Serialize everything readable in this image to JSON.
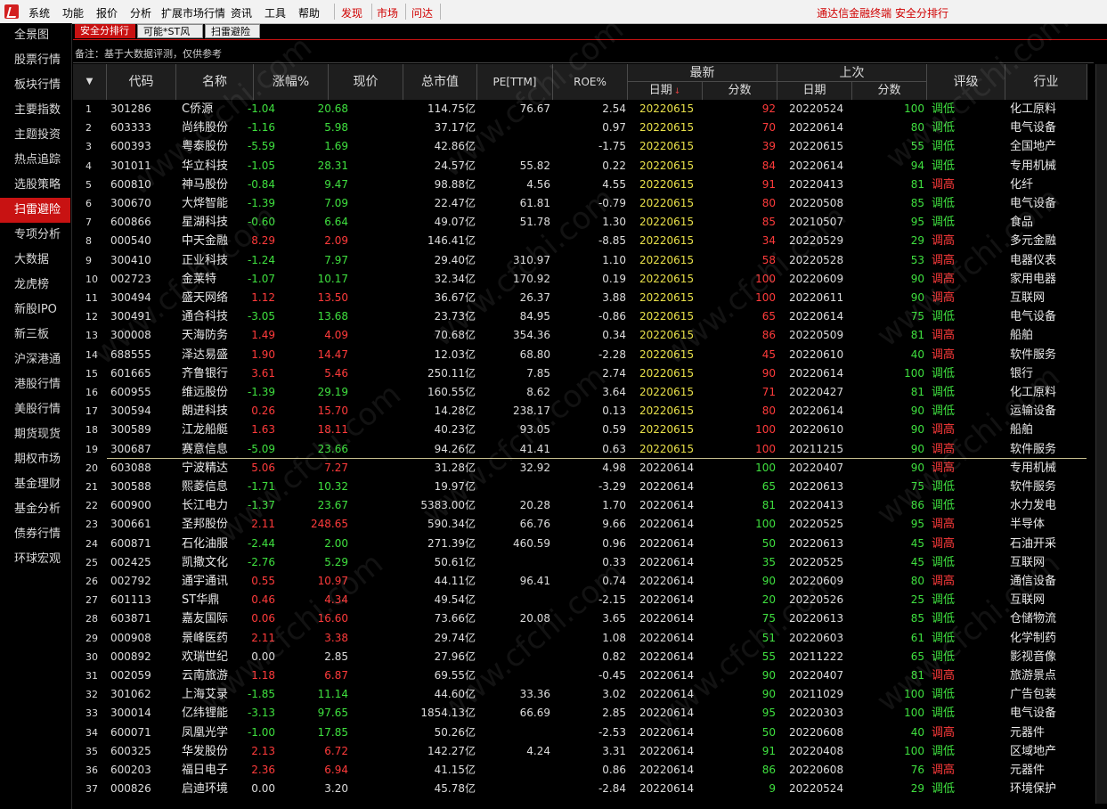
{
  "menu": {
    "items": [
      "系统",
      "功能",
      "报价",
      "分析",
      "扩展市场行情",
      "资讯",
      "工具",
      "帮助"
    ],
    "red_items": [
      "发现",
      "市场",
      "问达"
    ],
    "right_text": "通达信金融终端  安全分排行"
  },
  "sidebar": {
    "items": [
      "全景图",
      "股票行情",
      "板块行情",
      "主要指数",
      "主题投资",
      "热点追踪",
      "选股策略",
      "扫雷避险",
      "专项分析",
      "大数据",
      "龙虎榜",
      "新股IPO",
      "新三板",
      "沪深港通",
      "港股行情",
      "美股行情",
      "期货现货",
      "期权市场",
      "基金理财",
      "基金分析",
      "债券行情",
      "环球宏观"
    ],
    "active_index": 7
  },
  "tabs": [
    "安全分排行",
    "可能*ST风险",
    "扫雷避险"
  ],
  "note": "备注：基于大数据评测，仅供参考",
  "header": {
    "sort_icon": "sort-triangle-icon",
    "code": "代码",
    "name": "名称",
    "change": "涨幅%",
    "price": "现价",
    "market_cap": "总市值",
    "pe": "PE[TTM]",
    "roe": "ROE%",
    "latest": "最新",
    "previous": "上次",
    "date": "日期",
    "score": "分数",
    "rating": "评级",
    "industry": "行业"
  },
  "rows": [
    {
      "i": "1",
      "code": "301286",
      "name": "C侨源",
      "chg": "-1.04",
      "price": "20.68",
      "cap": "114.75亿",
      "pe": "76.67",
      "roe": "2.54",
      "d1": "20220615",
      "s1": "92",
      "d2": "20220524",
      "s2": "100",
      "rate": "调低",
      "ind": "化工原料"
    },
    {
      "i": "2",
      "code": "603333",
      "name": "尚纬股份",
      "chg": "-1.16",
      "price": "5.98",
      "cap": "37.17亿",
      "pe": "",
      "roe": "0.97",
      "d1": "20220615",
      "s1": "70",
      "d2": "20220614",
      "s2": "80",
      "rate": "调低",
      "ind": "电气设备"
    },
    {
      "i": "3",
      "code": "600393",
      "name": "粤泰股份",
      "chg": "-5.59",
      "price": "1.69",
      "cap": "42.86亿",
      "pe": "",
      "roe": "-1.75",
      "d1": "20220615",
      "s1": "39",
      "d2": "20220615",
      "s2": "55",
      "rate": "调低",
      "ind": "全国地产"
    },
    {
      "i": "4",
      "code": "301011",
      "name": "华立科技",
      "chg": "-1.05",
      "price": "28.31",
      "cap": "24.57亿",
      "pe": "55.82",
      "roe": "0.22",
      "d1": "20220615",
      "s1": "84",
      "d2": "20220614",
      "s2": "94",
      "rate": "调低",
      "ind": "专用机械"
    },
    {
      "i": "5",
      "code": "600810",
      "name": "神马股份",
      "chg": "-0.84",
      "price": "9.47",
      "cap": "98.88亿",
      "pe": "4.56",
      "roe": "4.55",
      "d1": "20220615",
      "s1": "91",
      "d2": "20220413",
      "s2": "81",
      "rate": "调高",
      "ind": "化纤"
    },
    {
      "i": "6",
      "code": "300670",
      "name": "大烨智能",
      "chg": "-1.39",
      "price": "7.09",
      "cap": "22.47亿",
      "pe": "61.81",
      "roe": "-0.79",
      "d1": "20220615",
      "s1": "80",
      "d2": "20220508",
      "s2": "85",
      "rate": "调低",
      "ind": "电气设备"
    },
    {
      "i": "7",
      "code": "600866",
      "name": "星湖科技",
      "chg": "-0.60",
      "price": "6.64",
      "cap": "49.07亿",
      "pe": "51.78",
      "roe": "1.30",
      "d1": "20220615",
      "s1": "85",
      "d2": "20210507",
      "s2": "95",
      "rate": "调低",
      "ind": "食品"
    },
    {
      "i": "8",
      "code": "000540",
      "name": "中天金融",
      "chg": "8.29",
      "price": "2.09",
      "cap": "146.41亿",
      "pe": "",
      "roe": "-8.85",
      "d1": "20220615",
      "s1": "34",
      "d2": "20220529",
      "s2": "29",
      "rate": "调高",
      "ind": "多元金融"
    },
    {
      "i": "9",
      "code": "300410",
      "name": "正业科技",
      "chg": "-1.24",
      "price": "7.97",
      "cap": "29.40亿",
      "pe": "310.97",
      "roe": "1.10",
      "d1": "20220615",
      "s1": "58",
      "d2": "20220528",
      "s2": "53",
      "rate": "调高",
      "ind": "电器仪表"
    },
    {
      "i": "10",
      "code": "002723",
      "name": "金莱特",
      "chg": "-1.07",
      "price": "10.17",
      "cap": "32.34亿",
      "pe": "170.92",
      "roe": "0.19",
      "d1": "20220615",
      "s1": "100",
      "d2": "20220609",
      "s2": "90",
      "rate": "调高",
      "ind": "家用电器"
    },
    {
      "i": "11",
      "code": "300494",
      "name": "盛天网络",
      "chg": "1.12",
      "price": "13.50",
      "cap": "36.67亿",
      "pe": "26.37",
      "roe": "3.88",
      "d1": "20220615",
      "s1": "100",
      "d2": "20220611",
      "s2": "90",
      "rate": "调高",
      "ind": "互联网"
    },
    {
      "i": "12",
      "code": "300491",
      "name": "通合科技",
      "chg": "-3.05",
      "price": "13.68",
      "cap": "23.73亿",
      "pe": "84.95",
      "roe": "-0.86",
      "d1": "20220615",
      "s1": "65",
      "d2": "20220614",
      "s2": "75",
      "rate": "调低",
      "ind": "电气设备"
    },
    {
      "i": "13",
      "code": "300008",
      "name": "天海防务",
      "chg": "1.49",
      "price": "4.09",
      "cap": "70.68亿",
      "pe": "354.36",
      "roe": "0.34",
      "d1": "20220615",
      "s1": "86",
      "d2": "20220509",
      "s2": "81",
      "rate": "调高",
      "ind": "船舶"
    },
    {
      "i": "14",
      "code": "688555",
      "name": "泽达易盛",
      "chg": "1.90",
      "price": "14.47",
      "cap": "12.03亿",
      "pe": "68.80",
      "roe": "-2.28",
      "d1": "20220615",
      "s1": "45",
      "d2": "20220610",
      "s2": "40",
      "rate": "调高",
      "ind": "软件服务"
    },
    {
      "i": "15",
      "code": "601665",
      "name": "齐鲁银行",
      "chg": "3.61",
      "price": "5.46",
      "cap": "250.11亿",
      "pe": "7.85",
      "roe": "2.74",
      "d1": "20220615",
      "s1": "90",
      "d2": "20220614",
      "s2": "100",
      "rate": "调低",
      "ind": "银行"
    },
    {
      "i": "16",
      "code": "600955",
      "name": "维远股份",
      "chg": "-1.39",
      "price": "29.19",
      "cap": "160.55亿",
      "pe": "8.62",
      "roe": "3.64",
      "d1": "20220615",
      "s1": "71",
      "d2": "20220427",
      "s2": "81",
      "rate": "调低",
      "ind": "化工原料"
    },
    {
      "i": "17",
      "code": "300594",
      "name": "朗进科技",
      "chg": "0.26",
      "price": "15.70",
      "cap": "14.28亿",
      "pe": "238.17",
      "roe": "0.13",
      "d1": "20220615",
      "s1": "80",
      "d2": "20220614",
      "s2": "90",
      "rate": "调低",
      "ind": "运输设备"
    },
    {
      "i": "18",
      "code": "300589",
      "name": "江龙船艇",
      "chg": "1.63",
      "price": "18.11",
      "cap": "40.23亿",
      "pe": "93.05",
      "roe": "0.59",
      "d1": "20220615",
      "s1": "100",
      "d2": "20220610",
      "s2": "90",
      "rate": "调高",
      "ind": "船舶"
    },
    {
      "i": "19",
      "code": "300687",
      "name": "赛意信息",
      "chg": "-5.09",
      "price": "23.66",
      "cap": "94.26亿",
      "pe": "41.41",
      "roe": "0.63",
      "d1": "20220615",
      "s1": "100",
      "d2": "20211215",
      "s2": "90",
      "rate": "调高",
      "ind": "软件服务"
    },
    {
      "i": "20",
      "code": "603088",
      "name": "宁波精达",
      "chg": "5.06",
      "price": "7.27",
      "cap": "31.28亿",
      "pe": "32.92",
      "roe": "4.98",
      "d1": "20220614",
      "s1": "100",
      "d2": "20220407",
      "s2": "90",
      "rate": "调高",
      "ind": "专用机械"
    },
    {
      "i": "21",
      "code": "300588",
      "name": "熙菱信息",
      "chg": "-1.71",
      "price": "10.32",
      "cap": "19.97亿",
      "pe": "",
      "roe": "-3.29",
      "d1": "20220614",
      "s1": "65",
      "d2": "20220613",
      "s2": "75",
      "rate": "调低",
      "ind": "软件服务"
    },
    {
      "i": "22",
      "code": "600900",
      "name": "长江电力",
      "chg": "-1.37",
      "price": "23.67",
      "cap": "5383.00亿",
      "pe": "20.28",
      "roe": "1.70",
      "d1": "20220614",
      "s1": "81",
      "d2": "20220413",
      "s2": "86",
      "rate": "调低",
      "ind": "水力发电"
    },
    {
      "i": "23",
      "code": "300661",
      "name": "圣邦股份",
      "chg": "2.11",
      "price": "248.65",
      "cap": "590.34亿",
      "pe": "66.76",
      "roe": "9.66",
      "d1": "20220614",
      "s1": "100",
      "d2": "20220525",
      "s2": "95",
      "rate": "调高",
      "ind": "半导体"
    },
    {
      "i": "24",
      "code": "600871",
      "name": "石化油服",
      "chg": "-2.44",
      "price": "2.00",
      "cap": "271.39亿",
      "pe": "460.59",
      "roe": "0.96",
      "d1": "20220614",
      "s1": "50",
      "d2": "20220613",
      "s2": "45",
      "rate": "调高",
      "ind": "石油开采"
    },
    {
      "i": "25",
      "code": "002425",
      "name": "凯撒文化",
      "chg": "-2.76",
      "price": "5.29",
      "cap": "50.61亿",
      "pe": "",
      "roe": "0.33",
      "d1": "20220614",
      "s1": "35",
      "d2": "20220525",
      "s2": "45",
      "rate": "调低",
      "ind": "互联网"
    },
    {
      "i": "26",
      "code": "002792",
      "name": "通宇通讯",
      "chg": "0.55",
      "price": "10.97",
      "cap": "44.11亿",
      "pe": "96.41",
      "roe": "0.74",
      "d1": "20220614",
      "s1": "90",
      "d2": "20220609",
      "s2": "80",
      "rate": "调高",
      "ind": "通信设备"
    },
    {
      "i": "27",
      "code": "601113",
      "name": "ST华鼎",
      "chg": "0.46",
      "price": "4.34",
      "cap": "49.54亿",
      "pe": "",
      "roe": "-2.15",
      "d1": "20220614",
      "s1": "20",
      "d2": "20220526",
      "s2": "25",
      "rate": "调低",
      "ind": "互联网"
    },
    {
      "i": "28",
      "code": "603871",
      "name": "嘉友国际",
      "chg": "0.06",
      "price": "16.60",
      "cap": "73.66亿",
      "pe": "20.08",
      "roe": "3.65",
      "d1": "20220614",
      "s1": "75",
      "d2": "20220613",
      "s2": "85",
      "rate": "调低",
      "ind": "仓储物流"
    },
    {
      "i": "29",
      "code": "000908",
      "name": "景峰医药",
      "chg": "2.11",
      "price": "3.38",
      "cap": "29.74亿",
      "pe": "",
      "roe": "1.08",
      "d1": "20220614",
      "s1": "51",
      "d2": "20220603",
      "s2": "61",
      "rate": "调低",
      "ind": "化学制药"
    },
    {
      "i": "30",
      "code": "000892",
      "name": "欢瑞世纪",
      "chg": "0.00",
      "price": "2.85",
      "cap": "27.96亿",
      "pe": "",
      "roe": "0.82",
      "d1": "20220614",
      "s1": "55",
      "d2": "20211222",
      "s2": "65",
      "rate": "调低",
      "ind": "影视音像"
    },
    {
      "i": "31",
      "code": "002059",
      "name": "云南旅游",
      "chg": "1.18",
      "price": "6.87",
      "cap": "69.55亿",
      "pe": "",
      "roe": "-0.45",
      "d1": "20220614",
      "s1": "90",
      "d2": "20220407",
      "s2": "81",
      "rate": "调高",
      "ind": "旅游景点"
    },
    {
      "i": "32",
      "code": "301062",
      "name": "上海艾录",
      "chg": "-1.85",
      "price": "11.14",
      "cap": "44.60亿",
      "pe": "33.36",
      "roe": "3.02",
      "d1": "20220614",
      "s1": "90",
      "d2": "20211029",
      "s2": "100",
      "rate": "调低",
      "ind": "广告包装"
    },
    {
      "i": "33",
      "code": "300014",
      "name": "亿纬锂能",
      "chg": "-3.13",
      "price": "97.65",
      "cap": "1854.13亿",
      "pe": "66.69",
      "roe": "2.85",
      "d1": "20220614",
      "s1": "95",
      "d2": "20220303",
      "s2": "100",
      "rate": "调低",
      "ind": "电气设备"
    },
    {
      "i": "34",
      "code": "600071",
      "name": "凤凰光学",
      "chg": "-1.00",
      "price": "17.85",
      "cap": "50.26亿",
      "pe": "",
      "roe": "-2.53",
      "d1": "20220614",
      "s1": "50",
      "d2": "20220608",
      "s2": "40",
      "rate": "调高",
      "ind": "元器件"
    },
    {
      "i": "35",
      "code": "600325",
      "name": "华发股份",
      "chg": "2.13",
      "price": "6.72",
      "cap": "142.27亿",
      "pe": "4.24",
      "roe": "3.31",
      "d1": "20220614",
      "s1": "91",
      "d2": "20220408",
      "s2": "100",
      "rate": "调低",
      "ind": "区域地产"
    },
    {
      "i": "36",
      "code": "600203",
      "name": "福日电子",
      "chg": "2.36",
      "price": "6.94",
      "cap": "41.15亿",
      "pe": "",
      "roe": "0.86",
      "d1": "20220614",
      "s1": "86",
      "d2": "20220608",
      "s2": "76",
      "rate": "调高",
      "ind": "元器件"
    },
    {
      "i": "37",
      "code": "000826",
      "name": "启迪环境",
      "chg": "0.00",
      "price": "3.20",
      "cap": "45.78亿",
      "pe": "",
      "roe": "-2.84",
      "d1": "20220614",
      "s1": "9",
      "d2": "20220524",
      "s2": "29",
      "rate": "调低",
      "ind": "环境保护"
    }
  ],
  "watermark": "www.cfchi.com",
  "colors": {
    "up": "#ff3b3b",
    "down": "#3fe03f",
    "yellow": "#e8e04a",
    "active": "#c81212"
  }
}
